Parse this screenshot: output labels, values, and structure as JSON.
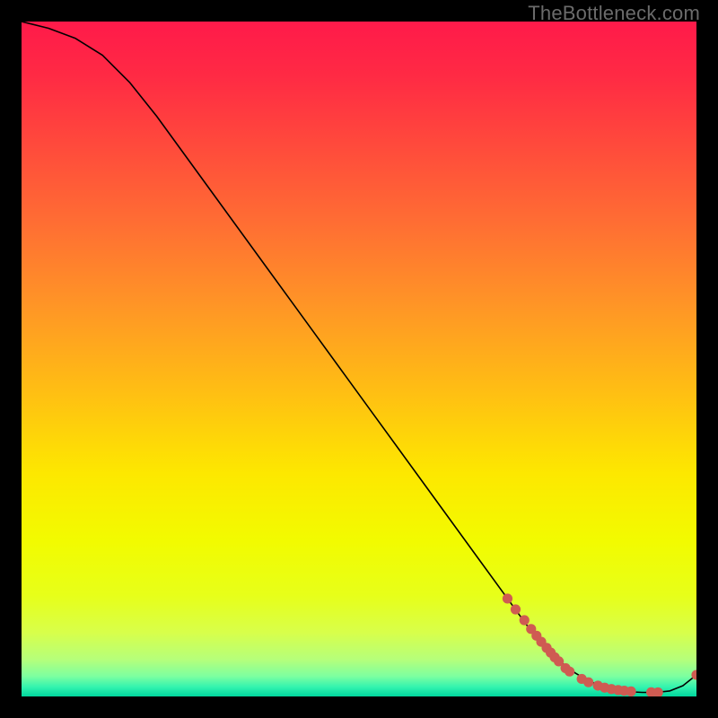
{
  "watermark": "TheBottleneck.com",
  "chart_data": {
    "type": "line",
    "title": "",
    "xlabel": "",
    "ylabel": "",
    "xlim": [
      0,
      100
    ],
    "ylim": [
      0,
      100
    ],
    "grid": false,
    "series": [
      {
        "name": "curve",
        "style": "line",
        "color": "#000000",
        "x": [
          0,
          4,
          8,
          12,
          16,
          20,
          24,
          28,
          32,
          36,
          40,
          44,
          48,
          52,
          56,
          60,
          64,
          68,
          72,
          76,
          80,
          82,
          84,
          86,
          88,
          90,
          92,
          94,
          96,
          98,
          100
        ],
        "y": [
          100,
          99,
          97.5,
          95,
          91,
          86,
          80.5,
          75,
          69.5,
          64,
          58.5,
          53,
          47.5,
          42,
          36.5,
          31,
          25.5,
          20,
          14.5,
          9,
          5,
          3.5,
          2.3,
          1.5,
          1.0,
          0.7,
          0.6,
          0.6,
          0.8,
          1.6,
          3.2
        ]
      },
      {
        "name": "highlight-points",
        "style": "scatter",
        "color": "#cf5b52",
        "x": [
          72,
          73.2,
          74.5,
          75.5,
          76.3,
          77.0,
          77.8,
          78.4,
          79.0,
          79.6,
          80.6,
          81.2,
          83.0,
          84.0,
          85.4,
          86.4,
          87.4,
          88.4,
          89.3,
          90.3,
          93.3,
          94.3,
          100
        ],
        "y": [
          14.5,
          12.9,
          11.3,
          10.0,
          9.0,
          8.1,
          7.2,
          6.5,
          5.8,
          5.2,
          4.2,
          3.7,
          2.6,
          2.1,
          1.6,
          1.3,
          1.1,
          0.95,
          0.85,
          0.75,
          0.62,
          0.6,
          3.2
        ]
      }
    ],
    "background_gradient": {
      "stops": [
        {
          "offset": 0.0,
          "color": "#ff1a4a"
        },
        {
          "offset": 0.08,
          "color": "#ff2a44"
        },
        {
          "offset": 0.18,
          "color": "#ff493c"
        },
        {
          "offset": 0.3,
          "color": "#ff6e33"
        },
        {
          "offset": 0.42,
          "color": "#ff9526"
        },
        {
          "offset": 0.55,
          "color": "#ffbf13"
        },
        {
          "offset": 0.67,
          "color": "#fde800"
        },
        {
          "offset": 0.77,
          "color": "#f2fb00"
        },
        {
          "offset": 0.85,
          "color": "#e7ff19"
        },
        {
          "offset": 0.905,
          "color": "#d8ff4a"
        },
        {
          "offset": 0.945,
          "color": "#b6ff7a"
        },
        {
          "offset": 0.97,
          "color": "#7dffa0"
        },
        {
          "offset": 0.986,
          "color": "#33f3af"
        },
        {
          "offset": 1.0,
          "color": "#00d69d"
        }
      ]
    }
  }
}
